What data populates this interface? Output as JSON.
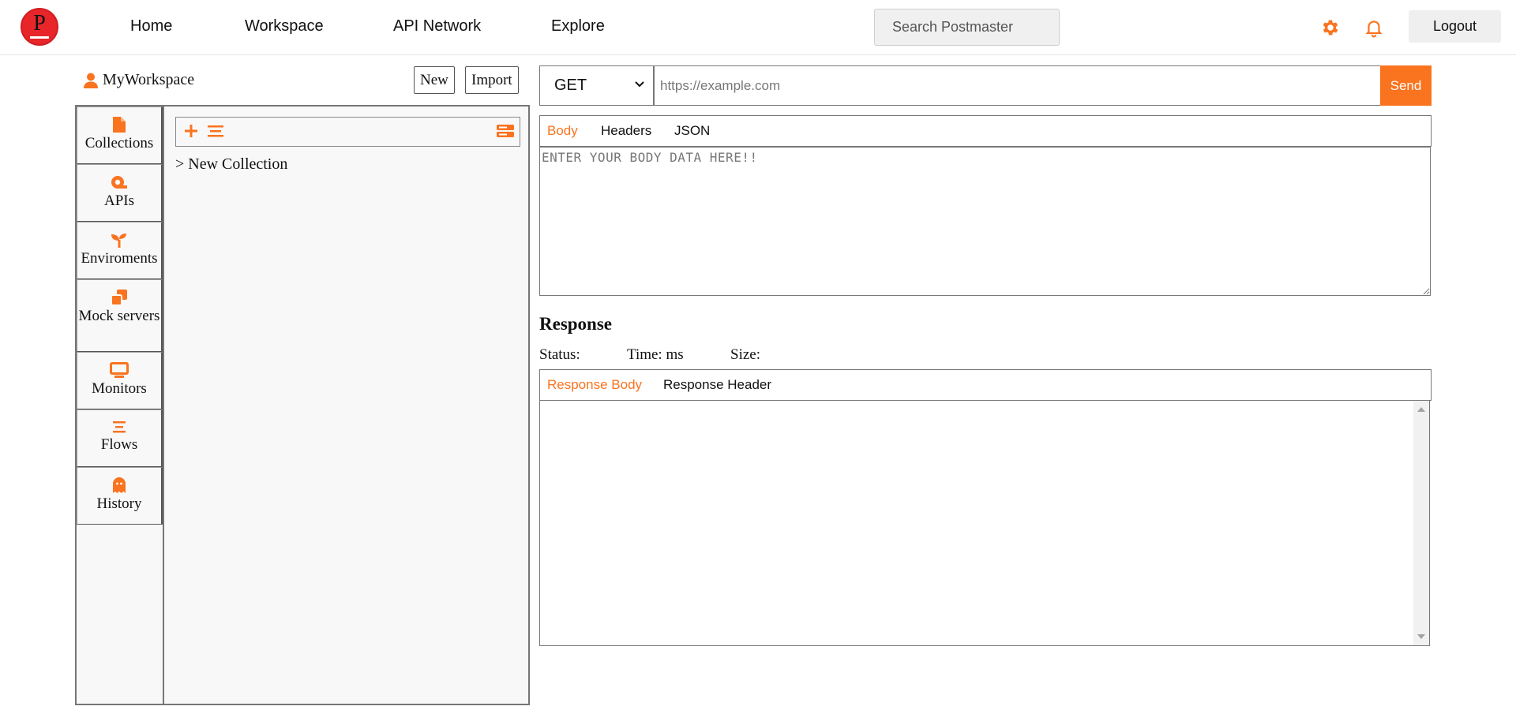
{
  "colors": {
    "accent": "#fa731f",
    "logo_red": "#e8262a",
    "border": "#767676"
  },
  "logo": {
    "letter": "P"
  },
  "nav": {
    "links": [
      {
        "label": "Home"
      },
      {
        "label": "Workspace"
      },
      {
        "label": "API Network"
      },
      {
        "label": "Explore"
      }
    ],
    "search_placeholder": "Search Postmaster",
    "settings_icon": "gear-icon",
    "notification_icon": "bell-icon",
    "logout_label": "Logout"
  },
  "workspace": {
    "title": "MyWorkspace",
    "user_icon": "user-icon",
    "new_label": "New",
    "import_label": "Import"
  },
  "sidebar": {
    "items": [
      {
        "label": "Collections",
        "icon": "file-icon"
      },
      {
        "label": "APIs",
        "icon": "api-icon"
      },
      {
        "label": "Enviroments",
        "icon": "sprout-icon"
      },
      {
        "label": "Mock servers",
        "icon": "clone-icon"
      },
      {
        "label": "Monitors",
        "icon": "monitor-icon"
      },
      {
        "label": "Flows",
        "icon": "bars-icon"
      },
      {
        "label": "History",
        "icon": "ghost-icon"
      }
    ]
  },
  "collections": {
    "toolbar_icons": [
      "plus-icon",
      "list-icon",
      "server-icon"
    ],
    "items": [
      {
        "label": "> New Collection"
      }
    ]
  },
  "request": {
    "method": "GET",
    "url_placeholder": "https://example.com",
    "send_label": "Send",
    "tabs": [
      {
        "label": "Body",
        "active": true
      },
      {
        "label": "Headers",
        "active": false
      },
      {
        "label": "JSON",
        "active": false
      }
    ],
    "body_placeholder": "ENTER YOUR BODY DATA HERE!!"
  },
  "response": {
    "title": "Response",
    "status_label": "Status:",
    "time_label": "Time: ms",
    "size_label": "Size:",
    "tabs": [
      {
        "label": "Response Body",
        "active": true
      },
      {
        "label": "Response Header",
        "active": false
      }
    ]
  }
}
